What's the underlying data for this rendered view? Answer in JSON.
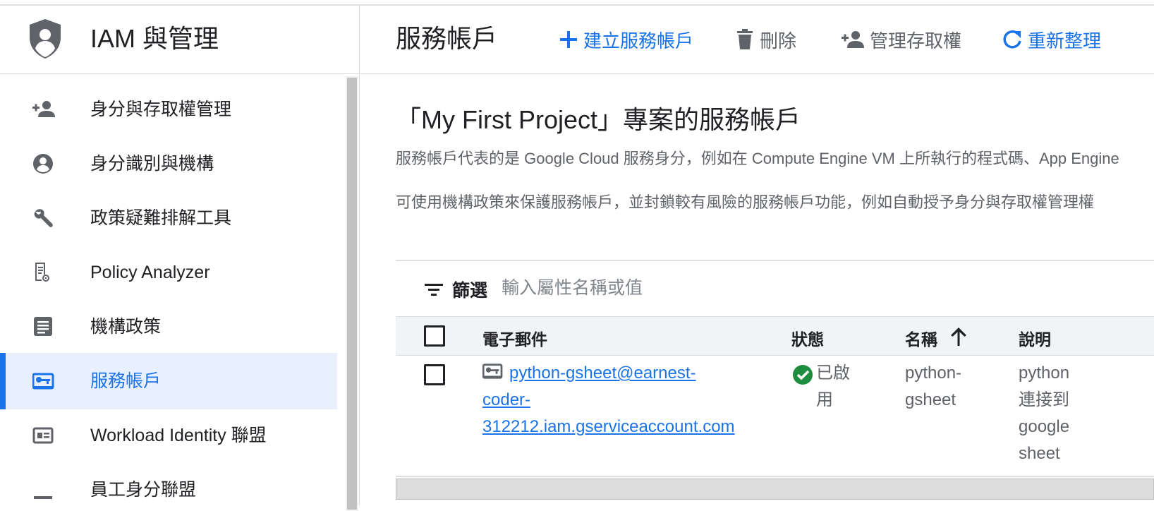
{
  "app": {
    "title": "IAM 與管理"
  },
  "sidebar": {
    "items": [
      {
        "label": "身分與存取權管理",
        "icon": "person-add-icon"
      },
      {
        "label": "身分識別與機構",
        "icon": "account-circle-icon"
      },
      {
        "label": "政策疑難排解工具",
        "icon": "wrench-icon"
      },
      {
        "label": "Policy Analyzer",
        "icon": "policy-doc-icon"
      },
      {
        "label": "機構政策",
        "icon": "list-doc-icon"
      },
      {
        "label": "服務帳戶",
        "icon": "service-account-icon",
        "active": true
      },
      {
        "label": "Workload Identity 聯盟",
        "icon": "id-card-icon"
      },
      {
        "label": "員工身分聯盟",
        "icon": "list-icon"
      }
    ]
  },
  "header": {
    "title": "服務帳戶",
    "create_label": "建立服務帳戶",
    "delete_label": "刪除",
    "manage_access_label": "管理存取權",
    "refresh_label": "重新整理"
  },
  "content": {
    "section_title": "「My First Project」專案的服務帳戶",
    "desc1": "服務帳戶代表的是 Google Cloud 服務身分，例如在 Compute Engine VM 上所執行的程式碼、App Engine",
    "desc2": "可使用機構政策來保護服務帳戶，並封鎖較有風險的服務帳戶功能，例如自動授予身分與存取權管理權"
  },
  "filter": {
    "label": "篩選",
    "placeholder": "輸入屬性名稱或值"
  },
  "table": {
    "columns": {
      "email": "電子郵件",
      "status": "狀態",
      "name": "名稱",
      "description": "說明"
    },
    "rows": [
      {
        "email_line1": "python-gsheet@earnest-",
        "email_line2": "coder-",
        "email_line3": "312212.iam.gserviceaccount.com",
        "status_line1": "已啟",
        "status_line2": "用",
        "name_line1": "python-",
        "name_line2": "gsheet",
        "desc_line1": "python",
        "desc_line2": "連接到",
        "desc_line3": "google",
        "desc_line4": "sheet"
      }
    ]
  },
  "colors": {
    "accent": "#1a73e8",
    "active_bg": "#e8f0fe",
    "success": "#1e8e3e"
  }
}
